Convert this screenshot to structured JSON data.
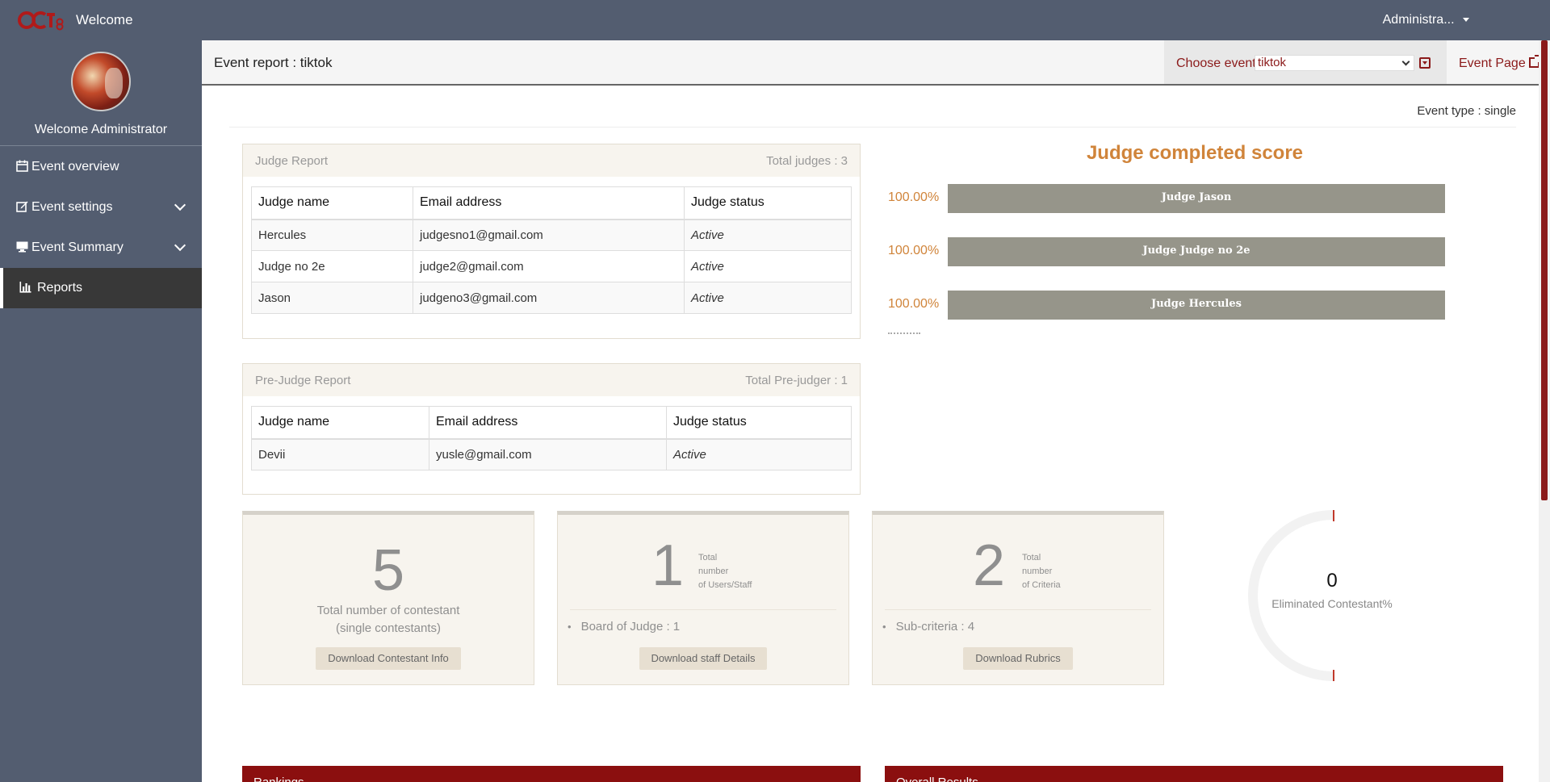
{
  "topbar": {
    "logo_alt": "OCT8",
    "title": "Welcome",
    "user_menu": "Administra..."
  },
  "sidebar": {
    "welcome": "Welcome Administrator",
    "items": [
      {
        "label": "Event overview",
        "icon": "calendar-icon"
      },
      {
        "label": "Event settings",
        "icon": "edit-icon"
      },
      {
        "label": "Event Summary",
        "icon": "desktop-icon"
      },
      {
        "label": "Reports",
        "icon": "bar-chart-icon"
      }
    ]
  },
  "header": {
    "title": "Event report : tiktok",
    "choose_label": "Choose event:",
    "selected_event": "tiktok",
    "event_page_link": "Event Page"
  },
  "event_type": "Event type : single",
  "judge_report": {
    "title": "Judge Report",
    "total": "Total judges : 3",
    "columns": [
      "Judge name",
      "Email address",
      "Judge status"
    ],
    "rows": [
      [
        "Hercules",
        "judgesno1@gmail.com",
        "Active"
      ],
      [
        "Judge no 2e",
        "judge2@gmail.com",
        "Active"
      ],
      [
        "Jason",
        "judgeno3@gmail.com",
        "Active"
      ]
    ]
  },
  "prejudge_report": {
    "title": "Pre-Judge Report",
    "total": "Total Pre-judger : 1",
    "columns": [
      "Judge name",
      "Email address",
      "Judge status"
    ],
    "rows": [
      [
        "Devii",
        "yusle@gmail.com",
        "Active"
      ]
    ]
  },
  "chart_data": {
    "type": "bar",
    "title": "Judge completed score",
    "categories": [
      "Judge Jason",
      "Judge Judge no 2e",
      "Judge Hercules"
    ],
    "values": [
      100,
      100,
      100
    ],
    "value_labels": [
      "100.00%",
      "100.00%",
      "100.00%"
    ],
    "orientation": "horizontal",
    "xlim": [
      0,
      100
    ],
    "bar_color": "#96958a",
    "label_color": "#d0843a"
  },
  "stats": {
    "contestants": {
      "value": "5",
      "desc_line1": "Total number of contestant",
      "desc_line2": "(single contestants)",
      "button": "Download Contestant Info"
    },
    "staff": {
      "value": "1",
      "desc": [
        "Total",
        "number",
        "of Users/Staff"
      ],
      "bullet": "Board of Judge : 1",
      "button": "Download staff Details"
    },
    "criteria": {
      "value": "2",
      "desc": [
        "Total",
        "number",
        "of Criteria"
      ],
      "bullet": "Sub-criteria : 4",
      "button": "Download Rubrics"
    }
  },
  "gauge": {
    "value": "0",
    "label": "Eliminated Contestant%",
    "percent": 0,
    "marker_color": "#c0392b",
    "track_color": "#f2f2f2"
  },
  "bottom_panels": [
    {
      "label": "Rankings"
    },
    {
      "label": "Overall Results"
    }
  ],
  "colors": {
    "topbar": "#535d70",
    "accent": "#8b1a1a",
    "chart_title": "#d0843a"
  }
}
